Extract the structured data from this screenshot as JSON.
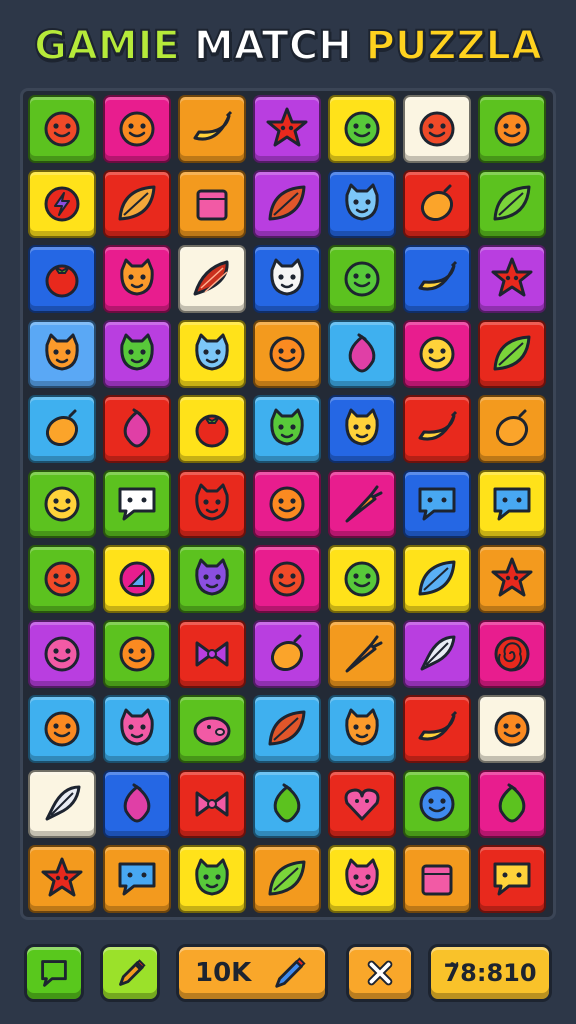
{
  "title": {
    "words": [
      {
        "text": "GAMIE",
        "color": "#b6ea3a"
      },
      {
        "text": "MATCH",
        "color": "#ffffff"
      },
      {
        "text": "PUZZLA",
        "color": "#ffd21f"
      }
    ]
  },
  "colors": {
    "green": "#5cc21f",
    "magenta": "#e81d8e",
    "orange": "#f39a1e",
    "purple": "#b93ee0",
    "yellow": "#ffe21a",
    "cream": "#fbf5e2",
    "red": "#e8291d",
    "blue": "#2567e4",
    "skyblue": "#3fb0ef",
    "lightblue": "#5aa8f5"
  },
  "board": {
    "columns": 7,
    "rows": 11,
    "tiles": [
      [
        "green:face-red",
        "magenta:face-orange",
        "orange:banana",
        "purple:star-red",
        "yellow:face-green",
        "cream:face-red",
        "green:face-orange"
      ],
      [
        "yellow:badge",
        "red:leaf-orange",
        "orange:box-pink",
        "purple:leaf-red",
        "blue:cat-blue",
        "red:lemon-orange",
        "green:leaf-green"
      ],
      [
        "blue:tomato",
        "magenta:cat-orange",
        "cream:pepper",
        "blue:cat-white",
        "green:face-green",
        "blue:banana",
        "purple:star-red"
      ],
      [
        "lightblue:cat-orange",
        "purple:cat-green",
        "yellow:cat-blue",
        "orange:face-orange",
        "skyblue:berry-pink",
        "magenta:face-yellow",
        "red:leaf-green"
      ],
      [
        "skyblue:lemon-orange",
        "red:berry-pink",
        "yellow:tomato",
        "skyblue:cat-green",
        "blue:cat-yellow",
        "red:banana",
        "orange:lemon-orange"
      ],
      [
        "green:face-yellow",
        "green:bubble-red",
        "red:cat-red",
        "magenta:face-orange",
        "magenta:carrot",
        "blue:bubble-blue",
        "yellow:bubble-blue"
      ],
      [
        "green:face-red",
        "yellow:badge-pink",
        "green:cat-purple",
        "magenta:face-red",
        "yellow:face-green",
        "yellow:leaf-blue",
        "orange:star-red"
      ],
      [
        "purple:face-pink",
        "green:face-orange",
        "red:bow-purple",
        "purple:lemon-orange",
        "orange:carrot",
        "purple:feather",
        "magenta:spiral"
      ],
      [
        "skyblue:face-orange",
        "skyblue:cat-pink",
        "green:pig-pink",
        "skyblue:leaf-red",
        "skyblue:cat-orange",
        "red:banana",
        "cream:face-orange"
      ],
      [
        "cream:feather",
        "blue:berry-pink",
        "red:bow-pink",
        "skyblue:berry-green",
        "red:heart-pink",
        "green:face-blue",
        "magenta:berry-green"
      ],
      [
        "orange:star-red",
        "orange:bubble-blue",
        "yellow:cat-green",
        "orange:leaf-green",
        "yellow:cat-pink",
        "orange:box-pink",
        "red:bubble-yellow"
      ]
    ]
  },
  "controls": {
    "hint_icon": "speech-bubble-icon",
    "pencil_icon": "pencil-icon",
    "score_text": "10K",
    "score_icon": "pencil-blue-icon",
    "close_icon": "close-icon",
    "timer_text": "7̃8:810"
  }
}
